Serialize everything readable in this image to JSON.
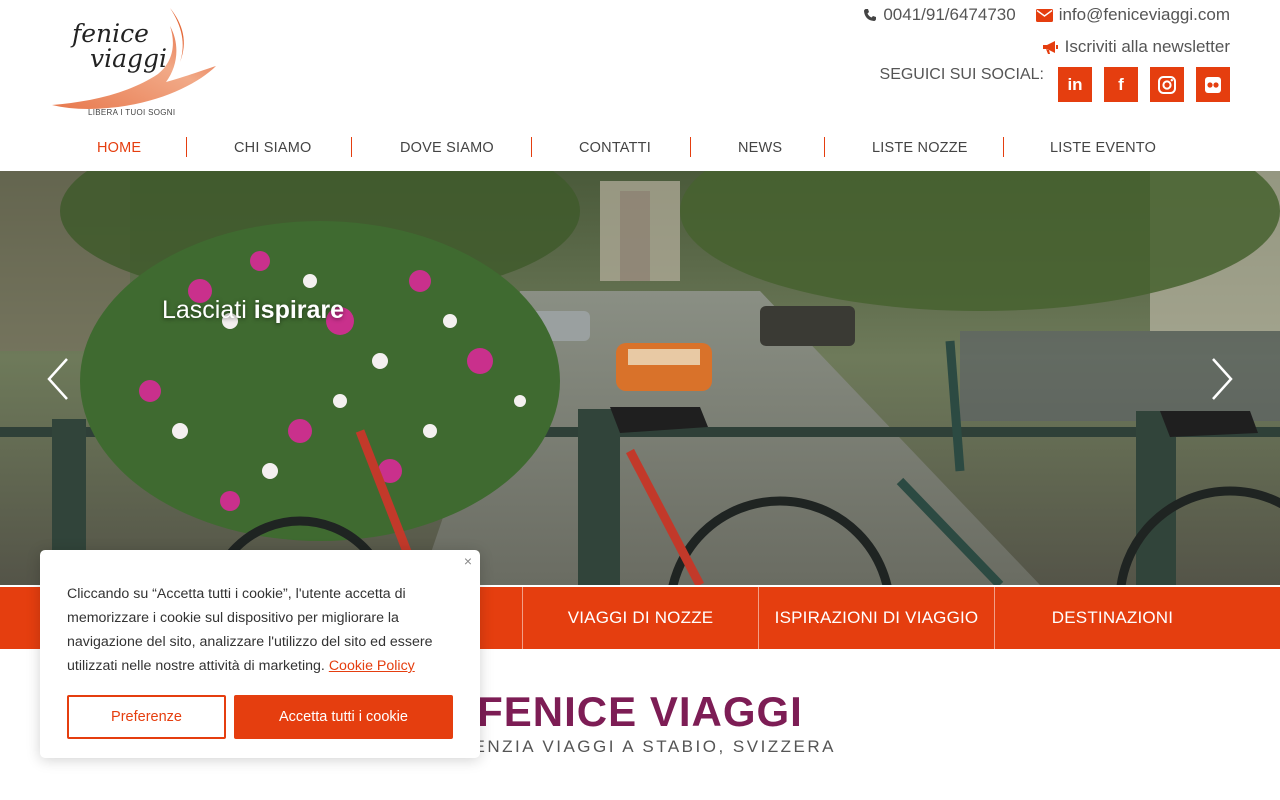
{
  "brand": {
    "logo_line1": "fenice",
    "logo_line2": "viaggi",
    "tagline": "LIBERA I TUOI SOGNI",
    "accent": "#e53e0f",
    "title_color": "#7d1d55"
  },
  "contact": {
    "phone": "0041/91/6474730",
    "phone_icon": "phone-icon",
    "email": "info@feniceviaggi.com",
    "email_icon": "envelope-icon",
    "newsletter": "Iscriviti alla newsletter",
    "newsletter_icon": "megaphone-icon"
  },
  "social": {
    "label": "SEGUICI SUI SOCIAL:",
    "items": [
      {
        "name": "linkedin-icon",
        "glyph": "in"
      },
      {
        "name": "facebook-icon",
        "glyph": "f"
      },
      {
        "name": "instagram-icon",
        "glyph": ""
      },
      {
        "name": "flickr-icon",
        "glyph": ""
      }
    ]
  },
  "nav": {
    "items": [
      {
        "label": "HOME",
        "active": true
      },
      {
        "label": "CHI SIAMO"
      },
      {
        "label": "DOVE SIAMO"
      },
      {
        "label": "CONTATTI"
      },
      {
        "label": "NEWS"
      },
      {
        "label": "LISTE NOZZE"
      },
      {
        "label": "LISTE EVENTO"
      }
    ]
  },
  "hero": {
    "caption_normal": "Lasciati",
    "caption_bold": "ispirare"
  },
  "tabs": {
    "items": [
      {
        "label": "VIAGGI DI NOZZE"
      },
      {
        "label": "ISPIRAZIONI DI VIAGGIO"
      },
      {
        "label": "DESTINAZIONI"
      }
    ]
  },
  "main": {
    "title": "FENICE VIAGGI",
    "subtitle": "AGENZIA VIAGGI A STABIO, SVIZZERA"
  },
  "cookie": {
    "close": "×",
    "text": "Cliccando su “Accetta tutti i cookie”, l'utente accetta di memorizzare i cookie sul dispositivo per migliorare la navigazione del sito, analizzare l'utilizzo del sito ed essere utilizzati nelle nostre attività di marketing.",
    "link": "Cookie Policy",
    "preferences": "Preferenze",
    "accept": "Accetta tutti i cookie"
  }
}
